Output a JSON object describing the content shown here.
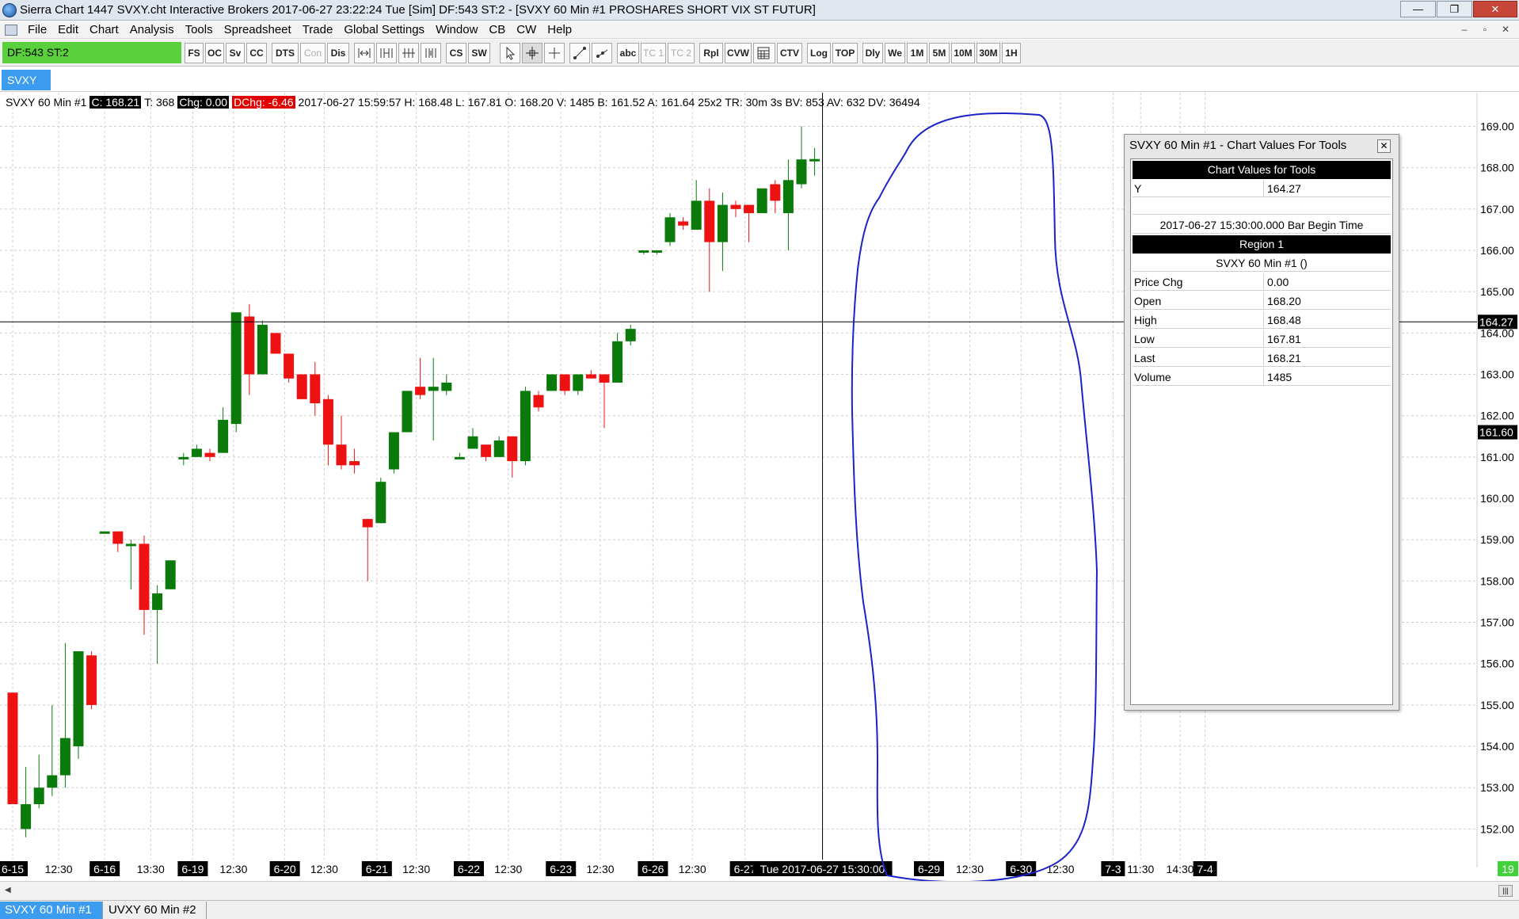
{
  "window": {
    "title": "Sierra Chart 1447 SVXY.cht  Interactive Brokers 2017-06-27  23:22:24 Tue [Sim]  DF:543  ST:2 - [SVXY  60 Min  #1  PROSHARES SHORT VIX ST FUTUR]",
    "minimize": "—",
    "maximize": "❐",
    "close": "✕",
    "mdi_min": "–",
    "mdi_max": "▫",
    "mdi_close": "✕"
  },
  "menu": [
    "File",
    "Edit",
    "Chart",
    "Analysis",
    "Tools",
    "Spreadsheet",
    "Trade",
    "Global Settings",
    "Window",
    "CB",
    "CW",
    "Help"
  ],
  "toolbar": {
    "status": "DF:543  ST:2",
    "buttons": [
      "FS",
      "OC",
      "Sv",
      "CC",
      "DTS",
      "Con",
      "Dis",
      "CS",
      "SW",
      "abc",
      "TC 1",
      "TC 2",
      "Rpl",
      "CVW",
      "CTV",
      "Log",
      "TOP",
      "Dly",
      "We",
      "1M",
      "5M",
      "10M",
      "30M",
      "1H"
    ]
  },
  "chart_tab": "SVXY",
  "status_line": {
    "symbol": "SVXY  60 Min  #1",
    "close": "C: 168.21",
    "trades": "T: 368",
    "chg": "Chg: 0.00",
    "dchg": "DChg: -6.46",
    "rest": "2017-06-27 15:59:57 H: 168.48 L: 167.81 O: 168.20 V: 1485 B: 161.52 A: 161.64 25x2 TR: 30m 3s BV: 853 AV: 632 DV: 36494"
  },
  "chart_data": {
    "type": "candlestick",
    "title": "",
    "ylim": [
      151.4,
      169.4
    ],
    "ytick_labels": [
      "169.00",
      "168.00",
      "167.00",
      "166.00",
      "165.00",
      "164.00",
      "163.00",
      "162.00",
      "161.00",
      "160.00",
      "159.00",
      "158.00",
      "157.00",
      "156.00",
      "155.00",
      "154.00",
      "153.00",
      "152.00"
    ],
    "y_markers": [
      {
        "label": "164.27",
        "value": 164.27,
        "color": "#000000"
      },
      {
        "label": "161.60",
        "value": 161.6,
        "color": "#000000"
      }
    ],
    "xtick_labels": [
      {
        "label": "6-15",
        "box": true,
        "slot": 0
      },
      {
        "label": "12:30",
        "box": false,
        "slot": 3.5
      },
      {
        "label": "6-16",
        "box": true,
        "slot": 7
      },
      {
        "label": "13:30",
        "box": false,
        "slot": 10.5
      },
      {
        "label": "6-19",
        "box": true,
        "slot": 13.7
      },
      {
        "label": "12:30",
        "box": false,
        "slot": 16.8
      },
      {
        "label": "6-20",
        "box": true,
        "slot": 20.7
      },
      {
        "label": "12:30",
        "box": false,
        "slot": 23.7
      },
      {
        "label": "6-21",
        "box": true,
        "slot": 27.7
      },
      {
        "label": "12:30",
        "box": false,
        "slot": 30.7
      },
      {
        "label": "6-22",
        "box": true,
        "slot": 34.7
      },
      {
        "label": "12:30",
        "box": false,
        "slot": 37.7
      },
      {
        "label": "6-23",
        "box": true,
        "slot": 41.7
      },
      {
        "label": "12:30",
        "box": false,
        "slot": 44.7
      },
      {
        "label": "6-26",
        "box": true,
        "slot": 48.7
      },
      {
        "label": "12:30",
        "box": false,
        "slot": 51.7
      },
      {
        "label": "6-27",
        "box": true,
        "slot": 55.7
      },
      {
        "label": "6-29",
        "box": true,
        "slot": 69.7
      },
      {
        "label": "12:30",
        "box": false,
        "slot": 72.8
      },
      {
        "label": "6-30",
        "box": true,
        "slot": 76.7
      },
      {
        "label": "12:30",
        "box": false,
        "slot": 79.7
      },
      {
        "label": "7-3",
        "box": true,
        "slot": 83.7
      },
      {
        "label": "11:30",
        "box": false,
        "slot": 85.8
      },
      {
        "label": "14:30",
        "box": false,
        "slot": 88.8
      },
      {
        "label": "7-4",
        "box": true,
        "slot": 90.7
      }
    ],
    "cursor_time_label": "Tue 2017-06-27  15:30:00",
    "right_edge_label": "19",
    "crosshair": {
      "price": 164.27,
      "slot": 61.6
    },
    "candles": [
      {
        "o": 155.3,
        "h": 155.3,
        "l": 152.6,
        "c": 152.6
      },
      {
        "o": 152.0,
        "h": 153.5,
        "l": 151.8,
        "c": 152.6
      },
      {
        "o": 152.6,
        "h": 153.8,
        "l": 152.5,
        "c": 153.0
      },
      {
        "o": 153.0,
        "h": 155.0,
        "l": 152.8,
        "c": 153.3
      },
      {
        "o": 153.3,
        "h": 156.5,
        "l": 153.0,
        "c": 154.2
      },
      {
        "o": 154.0,
        "h": 156.3,
        "l": 153.7,
        "c": 156.3
      },
      {
        "o": 156.2,
        "h": 156.3,
        "l": 154.9,
        "c": 155.0
      },
      {
        "o": 159.2,
        "h": 159.2,
        "l": 159.2,
        "c": 159.2
      },
      {
        "o": 159.2,
        "h": 159.2,
        "l": 158.7,
        "c": 158.9
      },
      {
        "o": 158.9,
        "h": 159.0,
        "l": 157.8,
        "c": 158.9
      },
      {
        "o": 158.9,
        "h": 159.1,
        "l": 156.7,
        "c": 157.3
      },
      {
        "o": 157.3,
        "h": 157.9,
        "l": 156.0,
        "c": 157.7
      },
      {
        "o": 157.8,
        "h": 158.5,
        "l": 157.8,
        "c": 158.5
      },
      {
        "o": 161.0,
        "h": 161.1,
        "l": 160.8,
        "c": 161.0
      },
      {
        "o": 161.0,
        "h": 161.3,
        "l": 161.0,
        "c": 161.2
      },
      {
        "o": 161.1,
        "h": 161.2,
        "l": 160.9,
        "c": 161.0
      },
      {
        "o": 161.1,
        "h": 162.2,
        "l": 161.1,
        "c": 161.9
      },
      {
        "o": 161.8,
        "h": 164.5,
        "l": 161.6,
        "c": 164.5
      },
      {
        "o": 164.4,
        "h": 164.7,
        "l": 162.5,
        "c": 163.0
      },
      {
        "o": 163.0,
        "h": 164.3,
        "l": 163.0,
        "c": 164.2
      },
      {
        "o": 164.0,
        "h": 164.0,
        "l": 163.5,
        "c": 163.5
      },
      {
        "o": 163.5,
        "h": 163.5,
        "l": 162.8,
        "c": 162.9
      },
      {
        "o": 163.0,
        "h": 163.0,
        "l": 162.4,
        "c": 162.4
      },
      {
        "o": 163.0,
        "h": 163.3,
        "l": 162.0,
        "c": 162.3
      },
      {
        "o": 162.4,
        "h": 162.5,
        "l": 160.8,
        "c": 161.3
      },
      {
        "o": 161.3,
        "h": 162.0,
        "l": 160.7,
        "c": 160.8
      },
      {
        "o": 160.9,
        "h": 161.2,
        "l": 160.6,
        "c": 160.8
      },
      {
        "o": 159.5,
        "h": 159.5,
        "l": 158.0,
        "c": 159.3
      },
      {
        "o": 159.4,
        "h": 160.5,
        "l": 159.4,
        "c": 160.4
      },
      {
        "o": 160.7,
        "h": 161.6,
        "l": 160.6,
        "c": 161.6
      },
      {
        "o": 161.6,
        "h": 162.6,
        "l": 161.6,
        "c": 162.6
      },
      {
        "o": 162.7,
        "h": 163.4,
        "l": 162.4,
        "c": 162.5
      },
      {
        "o": 162.6,
        "h": 163.4,
        "l": 161.4,
        "c": 162.7
      },
      {
        "o": 162.6,
        "h": 163.0,
        "l": 162.5,
        "c": 162.8
      },
      {
        "o": 161.0,
        "h": 161.1,
        "l": 161.0,
        "c": 161.0
      },
      {
        "o": 161.2,
        "h": 161.7,
        "l": 161.2,
        "c": 161.5
      },
      {
        "o": 161.3,
        "h": 161.3,
        "l": 160.9,
        "c": 161.0
      },
      {
        "o": 161.0,
        "h": 161.5,
        "l": 161.0,
        "c": 161.4
      },
      {
        "o": 161.5,
        "h": 161.5,
        "l": 160.5,
        "c": 160.9
      },
      {
        "o": 160.9,
        "h": 162.7,
        "l": 160.8,
        "c": 162.6
      },
      {
        "o": 162.5,
        "h": 162.6,
        "l": 162.1,
        "c": 162.2
      },
      {
        "o": 162.6,
        "h": 163.0,
        "l": 162.6,
        "c": 163.0
      },
      {
        "o": 163.0,
        "h": 163.0,
        "l": 162.5,
        "c": 162.6
      },
      {
        "o": 162.6,
        "h": 163.0,
        "l": 162.5,
        "c": 163.0
      },
      {
        "o": 163.0,
        "h": 163.1,
        "l": 162.9,
        "c": 162.9
      },
      {
        "o": 163.0,
        "h": 163.0,
        "l": 161.7,
        "c": 162.8
      },
      {
        "o": 162.8,
        "h": 164.0,
        "l": 162.8,
        "c": 163.8
      },
      {
        "o": 163.8,
        "h": 164.2,
        "l": 163.7,
        "c": 164.1
      },
      {
        "o": 166.0,
        "h": 166.0,
        "l": 165.9,
        "c": 166.0
      },
      {
        "o": 166.0,
        "h": 166.0,
        "l": 165.9,
        "c": 166.0
      },
      {
        "o": 166.2,
        "h": 166.9,
        "l": 166.1,
        "c": 166.8
      },
      {
        "o": 166.7,
        "h": 166.8,
        "l": 166.5,
        "c": 166.6
      },
      {
        "o": 166.5,
        "h": 167.7,
        "l": 166.5,
        "c": 167.2
      },
      {
        "o": 167.2,
        "h": 167.5,
        "l": 165.0,
        "c": 166.2
      },
      {
        "o": 166.2,
        "h": 167.4,
        "l": 165.5,
        "c": 167.1
      },
      {
        "o": 167.1,
        "h": 167.2,
        "l": 166.8,
        "c": 167.0
      },
      {
        "o": 167.1,
        "h": 167.1,
        "l": 166.2,
        "c": 166.9
      },
      {
        "o": 166.9,
        "h": 167.5,
        "l": 166.9,
        "c": 167.5
      },
      {
        "o": 167.6,
        "h": 167.7,
        "l": 166.9,
        "c": 167.2
      },
      {
        "o": 166.9,
        "h": 168.2,
        "l": 166.0,
        "c": 167.7
      },
      {
        "o": 167.6,
        "h": 169.0,
        "l": 167.5,
        "c": 168.2
      },
      {
        "o": 168.2,
        "h": 168.48,
        "l": 167.81,
        "c": 168.21
      }
    ],
    "colors": {
      "up": "#0a7a0a",
      "down": "#ee1111",
      "grid": "#cfcfcf",
      "annotation": "#1a23c8"
    }
  },
  "panel": {
    "title": "SVXY  60 Min   #1 - Chart Values For Tools",
    "close": "✕",
    "header": "Chart Values for Tools",
    "y_label": "Y",
    "y_value": "164.27",
    "bar_time": "2017-06-27  15:30:00.000  Bar Begin Time",
    "region": "Region 1",
    "study": "SVXY  60 Min   #1 ()",
    "rows": [
      {
        "k": "Price Chg",
        "v": "0.00"
      },
      {
        "k": "Open",
        "v": "168.20"
      },
      {
        "k": "High",
        "v": "168.48"
      },
      {
        "k": "Low",
        "v": "167.81"
      },
      {
        "k": "Last",
        "v": "168.21"
      },
      {
        "k": "Volume",
        "v": "1485"
      }
    ]
  },
  "bottom_tabs": [
    "SVXY  60 Min   #1",
    "UVXY  60 Min   #2"
  ],
  "scroll": {
    "thumb": "|||",
    "left_arrow": "◀"
  }
}
